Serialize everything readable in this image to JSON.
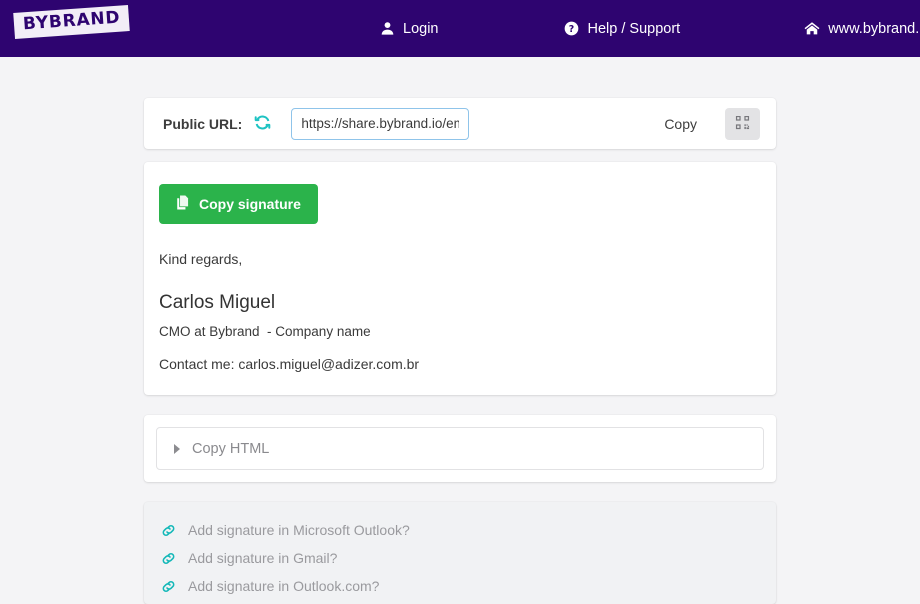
{
  "header": {
    "logo_text": "BYBRAND",
    "nav": [
      {
        "label": "Login",
        "icon": "user-icon"
      },
      {
        "label": "Help / Support",
        "icon": "question-circle-icon"
      },
      {
        "label": "www.bybrand.io",
        "icon": "home-icon"
      }
    ]
  },
  "url_bar": {
    "label": "Public URL:",
    "refresh_icon": "refresh-icon",
    "url_value": "https://share.bybrand.io/embed",
    "url_placeholder": "https://share.bybrand.io/",
    "copy_label": "Copy",
    "qr_icon": "qr-code-icon"
  },
  "signature": {
    "copy_button_label": "Copy signature",
    "copy_button_icon": "copy-icon",
    "regards": "Kind regards,",
    "name": "Carlos Miguel",
    "role": "CMO at Bybrand  - Company name",
    "contact": "Contact me: carlos.miguel@adizer.com.br"
  },
  "copy_html": {
    "label": "Copy HTML",
    "caret_icon": "caret-right-icon"
  },
  "help_links": [
    {
      "label": "Add signature in Microsoft Outlook?",
      "icon": "link-icon"
    },
    {
      "label": "Add signature in Gmail?",
      "icon": "link-icon"
    },
    {
      "label": "Add signature in Outlook.com?",
      "icon": "link-icon"
    }
  ],
  "colors": {
    "header_purple": "#2e0470",
    "green": "#2bb34b",
    "teal": "#1ec3c3",
    "page_bg": "#f4f4f6"
  }
}
